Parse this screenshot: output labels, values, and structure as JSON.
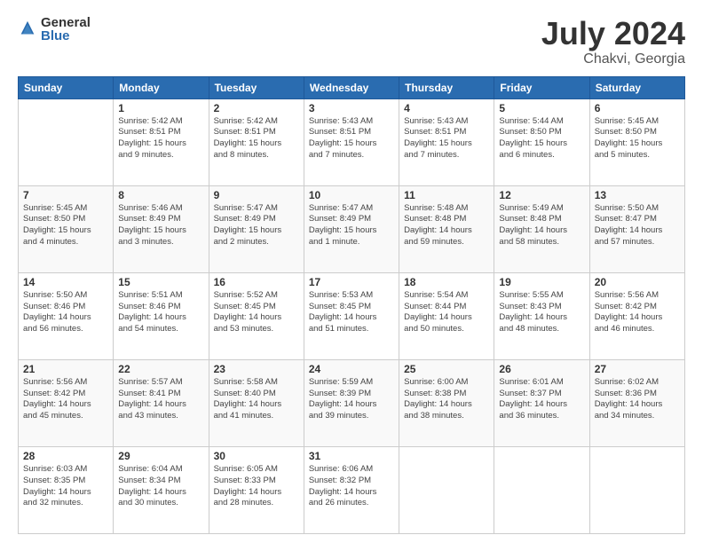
{
  "header": {
    "logo_general": "General",
    "logo_blue": "Blue",
    "month": "July 2024",
    "location": "Chakvi, Georgia"
  },
  "weekdays": [
    "Sunday",
    "Monday",
    "Tuesday",
    "Wednesday",
    "Thursday",
    "Friday",
    "Saturday"
  ],
  "weeks": [
    [
      {
        "day": "",
        "info": ""
      },
      {
        "day": "1",
        "info": "Sunrise: 5:42 AM\nSunset: 8:51 PM\nDaylight: 15 hours\nand 9 minutes."
      },
      {
        "day": "2",
        "info": "Sunrise: 5:42 AM\nSunset: 8:51 PM\nDaylight: 15 hours\nand 8 minutes."
      },
      {
        "day": "3",
        "info": "Sunrise: 5:43 AM\nSunset: 8:51 PM\nDaylight: 15 hours\nand 7 minutes."
      },
      {
        "day": "4",
        "info": "Sunrise: 5:43 AM\nSunset: 8:51 PM\nDaylight: 15 hours\nand 7 minutes."
      },
      {
        "day": "5",
        "info": "Sunrise: 5:44 AM\nSunset: 8:50 PM\nDaylight: 15 hours\nand 6 minutes."
      },
      {
        "day": "6",
        "info": "Sunrise: 5:45 AM\nSunset: 8:50 PM\nDaylight: 15 hours\nand 5 minutes."
      }
    ],
    [
      {
        "day": "7",
        "info": "Sunrise: 5:45 AM\nSunset: 8:50 PM\nDaylight: 15 hours\nand 4 minutes."
      },
      {
        "day": "8",
        "info": "Sunrise: 5:46 AM\nSunset: 8:49 PM\nDaylight: 15 hours\nand 3 minutes."
      },
      {
        "day": "9",
        "info": "Sunrise: 5:47 AM\nSunset: 8:49 PM\nDaylight: 15 hours\nand 2 minutes."
      },
      {
        "day": "10",
        "info": "Sunrise: 5:47 AM\nSunset: 8:49 PM\nDaylight: 15 hours\nand 1 minute."
      },
      {
        "day": "11",
        "info": "Sunrise: 5:48 AM\nSunset: 8:48 PM\nDaylight: 14 hours\nand 59 minutes."
      },
      {
        "day": "12",
        "info": "Sunrise: 5:49 AM\nSunset: 8:48 PM\nDaylight: 14 hours\nand 58 minutes."
      },
      {
        "day": "13",
        "info": "Sunrise: 5:50 AM\nSunset: 8:47 PM\nDaylight: 14 hours\nand 57 minutes."
      }
    ],
    [
      {
        "day": "14",
        "info": "Sunrise: 5:50 AM\nSunset: 8:46 PM\nDaylight: 14 hours\nand 56 minutes."
      },
      {
        "day": "15",
        "info": "Sunrise: 5:51 AM\nSunset: 8:46 PM\nDaylight: 14 hours\nand 54 minutes."
      },
      {
        "day": "16",
        "info": "Sunrise: 5:52 AM\nSunset: 8:45 PM\nDaylight: 14 hours\nand 53 minutes."
      },
      {
        "day": "17",
        "info": "Sunrise: 5:53 AM\nSunset: 8:45 PM\nDaylight: 14 hours\nand 51 minutes."
      },
      {
        "day": "18",
        "info": "Sunrise: 5:54 AM\nSunset: 8:44 PM\nDaylight: 14 hours\nand 50 minutes."
      },
      {
        "day": "19",
        "info": "Sunrise: 5:55 AM\nSunset: 8:43 PM\nDaylight: 14 hours\nand 48 minutes."
      },
      {
        "day": "20",
        "info": "Sunrise: 5:56 AM\nSunset: 8:42 PM\nDaylight: 14 hours\nand 46 minutes."
      }
    ],
    [
      {
        "day": "21",
        "info": "Sunrise: 5:56 AM\nSunset: 8:42 PM\nDaylight: 14 hours\nand 45 minutes."
      },
      {
        "day": "22",
        "info": "Sunrise: 5:57 AM\nSunset: 8:41 PM\nDaylight: 14 hours\nand 43 minutes."
      },
      {
        "day": "23",
        "info": "Sunrise: 5:58 AM\nSunset: 8:40 PM\nDaylight: 14 hours\nand 41 minutes."
      },
      {
        "day": "24",
        "info": "Sunrise: 5:59 AM\nSunset: 8:39 PM\nDaylight: 14 hours\nand 39 minutes."
      },
      {
        "day": "25",
        "info": "Sunrise: 6:00 AM\nSunset: 8:38 PM\nDaylight: 14 hours\nand 38 minutes."
      },
      {
        "day": "26",
        "info": "Sunrise: 6:01 AM\nSunset: 8:37 PM\nDaylight: 14 hours\nand 36 minutes."
      },
      {
        "day": "27",
        "info": "Sunrise: 6:02 AM\nSunset: 8:36 PM\nDaylight: 14 hours\nand 34 minutes."
      }
    ],
    [
      {
        "day": "28",
        "info": "Sunrise: 6:03 AM\nSunset: 8:35 PM\nDaylight: 14 hours\nand 32 minutes."
      },
      {
        "day": "29",
        "info": "Sunrise: 6:04 AM\nSunset: 8:34 PM\nDaylight: 14 hours\nand 30 minutes."
      },
      {
        "day": "30",
        "info": "Sunrise: 6:05 AM\nSunset: 8:33 PM\nDaylight: 14 hours\nand 28 minutes."
      },
      {
        "day": "31",
        "info": "Sunrise: 6:06 AM\nSunset: 8:32 PM\nDaylight: 14 hours\nand 26 minutes."
      },
      {
        "day": "",
        "info": ""
      },
      {
        "day": "",
        "info": ""
      },
      {
        "day": "",
        "info": ""
      }
    ]
  ]
}
